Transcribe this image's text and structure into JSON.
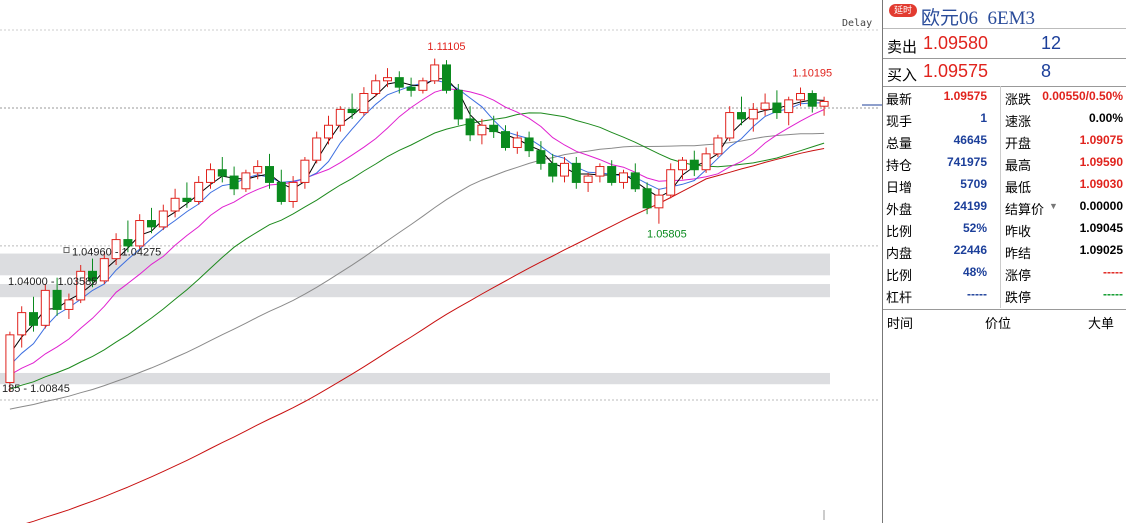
{
  "header": {
    "badge": "延时",
    "name": "欧元06",
    "code": "6EM3",
    "delay": "Delay"
  },
  "quotes": {
    "sell_label": "卖出",
    "sell_price": "1.09580",
    "sell_vol": "12",
    "buy_label": "买入",
    "buy_price": "1.09575",
    "buy_vol": "8"
  },
  "stats": [
    {
      "l1": "最新",
      "v1": "1.09575",
      "c1": "red",
      "l2": "涨跌",
      "v2": "0.00550/0.50%",
      "c2": "red"
    },
    {
      "l1": "现手",
      "v1": "1",
      "c1": "blue",
      "l2": "速涨",
      "v2": "0.00%",
      "c2": "blk"
    },
    {
      "l1": "总量",
      "v1": "46645",
      "c1": "blue",
      "l2": "开盘",
      "v2": "1.09075",
      "c2": "red"
    },
    {
      "l1": "持仓",
      "v1": "741975",
      "c1": "blue",
      "l2": "最高",
      "v2": "1.09590",
      "c2": "red"
    },
    {
      "l1": "日增",
      "v1": "5709",
      "c1": "blue",
      "l2": "最低",
      "v2": "1.09030",
      "c2": "red"
    },
    {
      "l1": "外盘",
      "v1": "24199",
      "c1": "blue",
      "l2": "结算价",
      "v2": "0.00000",
      "c2": "blk"
    },
    {
      "l1": "比例",
      "v1": "52%",
      "c1": "blue",
      "l2": "昨收",
      "v2": "1.09045",
      "c2": "blk"
    },
    {
      "l1": "内盘",
      "v1": "22446",
      "c1": "blue",
      "l2": "昨结",
      "v2": "1.09025",
      "c2": "blk"
    },
    {
      "l1": "比例",
      "v1": "48%",
      "c1": "blue",
      "l2": "涨停",
      "v2": "-----",
      "c2": "red"
    },
    {
      "l1": "杠杆",
      "v1": "-----",
      "c1": "blue",
      "l2": "跌停",
      "v2": "-----",
      "c2": "green"
    }
  ],
  "tick_headers": {
    "time": "时间",
    "price": "价位",
    "size": "大单"
  },
  "colors": {
    "up": "#e0231d",
    "down": "#0a8a1e",
    "ma5": "#000000",
    "ma10": "#3d6fe0",
    "ma20": "#e020d0",
    "ma40": "#1d8a1d",
    "ma60": "#8a8a8a",
    "ma120": "#c81010"
  },
  "chart_data": {
    "type": "candlestick",
    "annotations": {
      "high_label": "1.11105",
      "recent_high_label": "1.10195",
      "low_label": "1.05805",
      "zone_1": "1.04960 - 1.04275",
      "zone_2": "1.04000 - 1.03585",
      "zone_3": "185 - 1.00845"
    },
    "ohlc": [
      [
        1.009,
        1.025,
        1.006,
        1.024
      ],
      [
        1.024,
        1.033,
        1.02,
        1.031
      ],
      [
        1.031,
        1.036,
        1.025,
        1.027
      ],
      [
        1.027,
        1.04,
        1.026,
        1.038
      ],
      [
        1.038,
        1.042,
        1.03,
        1.032
      ],
      [
        1.032,
        1.037,
        1.029,
        1.035
      ],
      [
        1.035,
        1.046,
        1.034,
        1.044
      ],
      [
        1.044,
        1.048,
        1.039,
        1.041
      ],
      [
        1.041,
        1.05,
        1.04,
        1.048
      ],
      [
        1.048,
        1.056,
        1.046,
        1.054
      ],
      [
        1.054,
        1.06,
        1.05,
        1.052
      ],
      [
        1.052,
        1.062,
        1.051,
        1.06
      ],
      [
        1.06,
        1.064,
        1.056,
        1.058
      ],
      [
        1.058,
        1.065,
        1.057,
        1.063
      ],
      [
        1.063,
        1.07,
        1.061,
        1.067
      ],
      [
        1.067,
        1.072,
        1.064,
        1.066
      ],
      [
        1.066,
        1.074,
        1.065,
        1.072
      ],
      [
        1.072,
        1.078,
        1.07,
        1.076
      ],
      [
        1.076,
        1.08,
        1.072,
        1.074
      ],
      [
        1.074,
        1.077,
        1.068,
        1.07
      ],
      [
        1.07,
        1.076,
        1.069,
        1.075
      ],
      [
        1.075,
        1.079,
        1.073,
        1.077
      ],
      [
        1.077,
        1.081,
        1.07,
        1.072
      ],
      [
        1.072,
        1.076,
        1.065,
        1.066
      ],
      [
        1.066,
        1.074,
        1.064,
        1.072
      ],
      [
        1.072,
        1.08,
        1.07,
        1.079
      ],
      [
        1.079,
        1.088,
        1.078,
        1.086
      ],
      [
        1.086,
        1.093,
        1.084,
        1.09
      ],
      [
        1.09,
        1.096,
        1.088,
        1.095
      ],
      [
        1.095,
        1.1,
        1.092,
        1.094
      ],
      [
        1.094,
        1.102,
        1.093,
        1.1
      ],
      [
        1.1,
        1.106,
        1.099,
        1.104
      ],
      [
        1.104,
        1.108,
        1.102,
        1.105
      ],
      [
        1.105,
        1.107,
        1.1,
        1.102
      ],
      [
        1.102,
        1.105,
        1.099,
        1.101
      ],
      [
        1.101,
        1.105,
        1.1,
        1.104
      ],
      [
        1.104,
        1.111,
        1.103,
        1.109
      ],
      [
        1.109,
        1.1105,
        1.1,
        1.101
      ],
      [
        1.101,
        1.103,
        1.09,
        1.092
      ],
      [
        1.092,
        1.096,
        1.085,
        1.087
      ],
      [
        1.087,
        1.092,
        1.084,
        1.09
      ],
      [
        1.09,
        1.093,
        1.086,
        1.088
      ],
      [
        1.088,
        1.09,
        1.082,
        1.083
      ],
      [
        1.083,
        1.088,
        1.081,
        1.086
      ],
      [
        1.086,
        1.088,
        1.08,
        1.082
      ],
      [
        1.082,
        1.085,
        1.076,
        1.078
      ],
      [
        1.078,
        1.081,
        1.072,
        1.074
      ],
      [
        1.074,
        1.08,
        1.072,
        1.078
      ],
      [
        1.078,
        1.08,
        1.07,
        1.072
      ],
      [
        1.072,
        1.075,
        1.069,
        1.074
      ],
      [
        1.074,
        1.078,
        1.072,
        1.077
      ],
      [
        1.077,
        1.079,
        1.071,
        1.072
      ],
      [
        1.072,
        1.076,
        1.07,
        1.075
      ],
      [
        1.075,
        1.078,
        1.069,
        1.07
      ],
      [
        1.07,
        1.072,
        1.062,
        1.064
      ],
      [
        1.064,
        1.07,
        1.059,
        1.068
      ],
      [
        1.068,
        1.078,
        1.067,
        1.076
      ],
      [
        1.076,
        1.08,
        1.073,
        1.079
      ],
      [
        1.079,
        1.082,
        1.074,
        1.076
      ],
      [
        1.076,
        1.083,
        1.075,
        1.081
      ],
      [
        1.081,
        1.087,
        1.08,
        1.086
      ],
      [
        1.086,
        1.096,
        1.085,
        1.094
      ],
      [
        1.094,
        1.099,
        1.09,
        1.092
      ],
      [
        1.092,
        1.097,
        1.088,
        1.095
      ],
      [
        1.095,
        1.1,
        1.093,
        1.097
      ],
      [
        1.097,
        1.101,
        1.092,
        1.094
      ],
      [
        1.094,
        1.099,
        1.09,
        1.098
      ],
      [
        1.098,
        1.1019,
        1.096,
        1.1
      ],
      [
        1.1,
        1.101,
        1.094,
        1.096
      ],
      [
        1.096,
        1.099,
        1.093,
        1.0975
      ]
    ]
  }
}
